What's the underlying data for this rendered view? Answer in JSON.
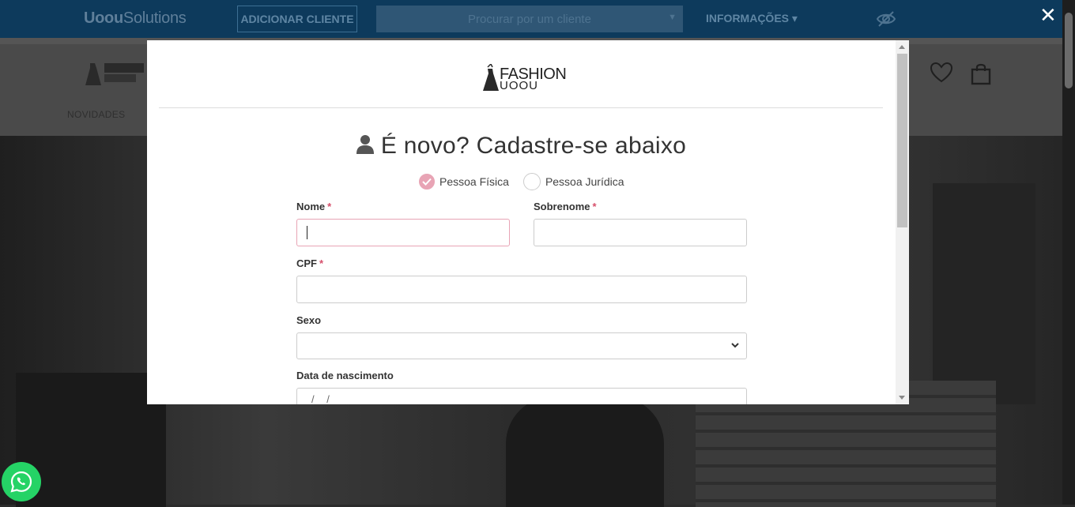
{
  "topbar": {
    "brand_bold": "Uoou",
    "brand_light": "Solutions",
    "add_client_label": "ADICIONAR CLIENTE",
    "client_search_placeholder": "Procurar por um cliente",
    "info_label": "INFORMAÇÕES",
    "info_caret": "▾"
  },
  "store": {
    "nav_first_item": "NOVIDADES"
  },
  "modal": {
    "logo_text_top": "FASHION",
    "logo_text_bottom": "UOOU",
    "title": "É novo? Cadastre-se abaixo",
    "person_type": {
      "options": [
        "Pessoa Física",
        "Pessoa Jurídica"
      ],
      "selected": "Pessoa Física"
    },
    "fields": {
      "nome": {
        "label": "Nome",
        "required_mark": "*",
        "value": ""
      },
      "sobrenome": {
        "label": "Sobrenome",
        "required_mark": "*",
        "value": ""
      },
      "cpf": {
        "label": "CPF",
        "required_mark": "*",
        "value": ""
      },
      "sexo": {
        "label": "Sexo",
        "value": ""
      },
      "nascimento": {
        "label": "Data de nascimento",
        "placeholder": "/ /"
      }
    }
  },
  "close_label": "✕",
  "colors": {
    "topbar": "#0d3a5c",
    "accent_pink": "#e8a4b5",
    "required_red": "#d64f6b",
    "whatsapp_green": "#25d366"
  }
}
